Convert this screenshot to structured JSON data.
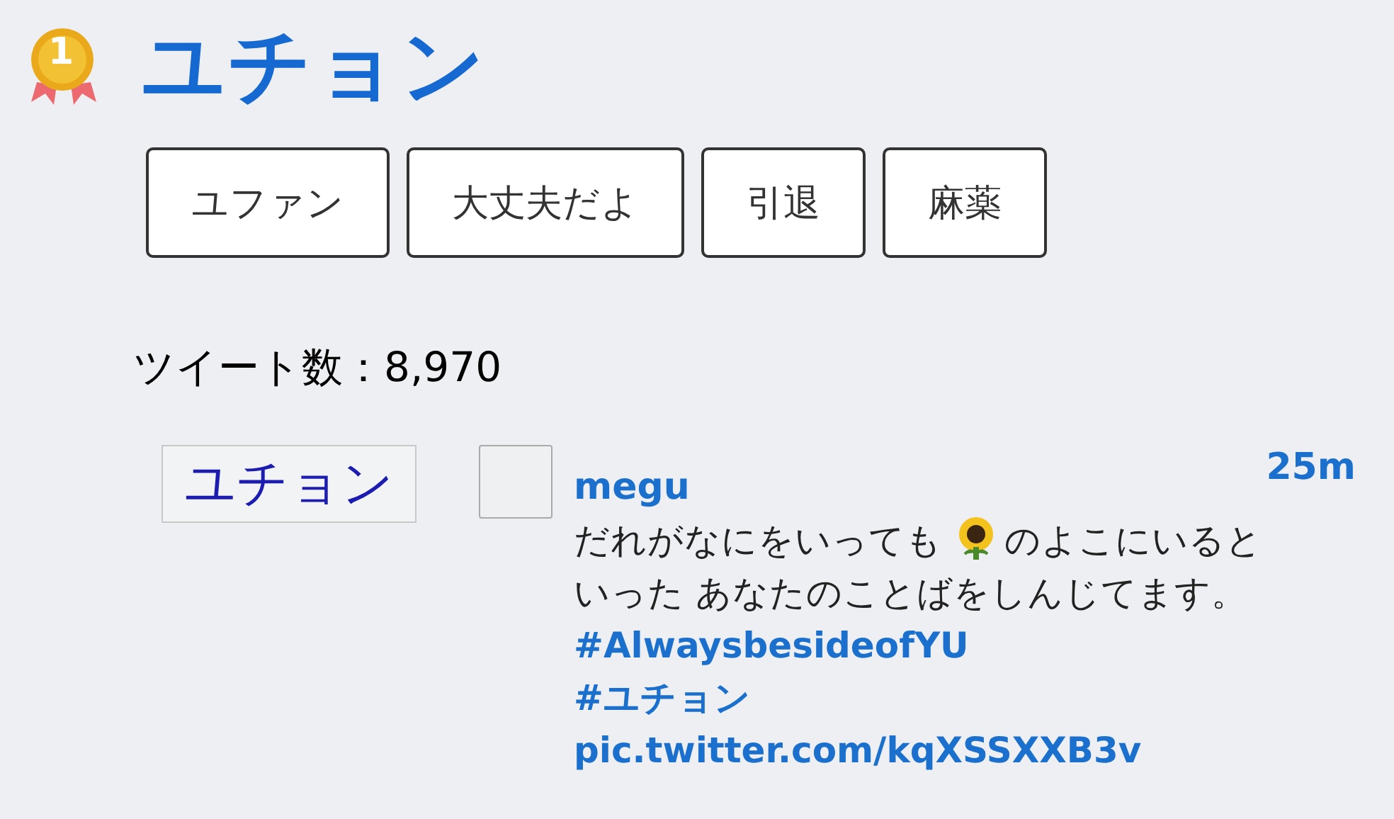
{
  "header": {
    "rank": "1",
    "title": "ユチョン"
  },
  "tags": [
    {
      "label": "ユファン"
    },
    {
      "label": "大丈夫だよ"
    },
    {
      "label": "引退"
    },
    {
      "label": "麻薬"
    }
  ],
  "tweet_count": {
    "label": "ツイート数：",
    "value": "8,970"
  },
  "search_term": "ユチョン",
  "tweet": {
    "user": "megu",
    "time": "25m",
    "body": [
      {
        "kind": "text",
        "text": "だれがなにをいっても"
      },
      {
        "kind": "emoji"
      },
      {
        "kind": "text",
        "text": "のよこにいると"
      },
      {
        "kind": "break"
      },
      {
        "kind": "text",
        "text": "いった あなたのことばをしんじてます。"
      }
    ],
    "links": [
      "#AlwaysbesideofYU",
      "#ユチョン",
      "pic.twitter.com/kqXSSXXB3v"
    ]
  }
}
